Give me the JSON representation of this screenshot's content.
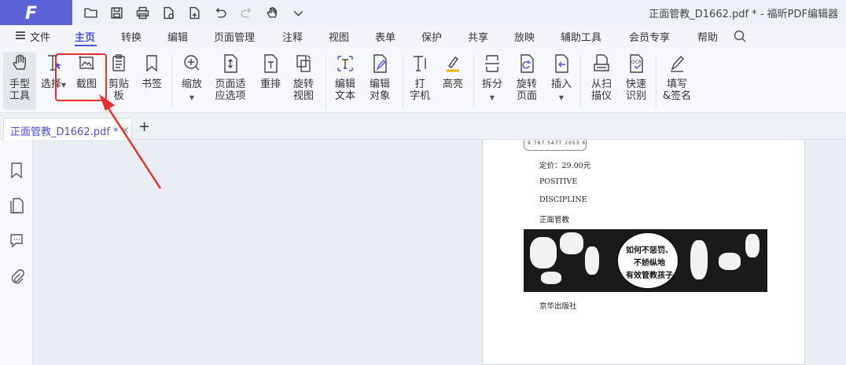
{
  "window": {
    "title": "正面管教_D1662.pdf * - 福昕PDF编辑器",
    "logo_text": "F"
  },
  "quick_access": [
    "open-folder",
    "save",
    "print",
    "page-export",
    "add-page",
    "undo",
    "redo",
    "hand-select",
    "more"
  ],
  "menu": {
    "file": "文件",
    "items": [
      "主页",
      "转换",
      "编辑",
      "页面管理",
      "注释",
      "视图",
      "表单",
      "保护",
      "共享",
      "放映",
      "辅助工具",
      "会员专享",
      "帮助"
    ],
    "active": "主页"
  },
  "ribbon": {
    "hand": "手型\n工具",
    "select": "选择",
    "screenshot": "截图",
    "clipboard": "剪贴\n板",
    "bookmark": "书签",
    "zoom": "缩放",
    "fit_page": "页面适\n应选项",
    "reflow": "重排",
    "rotate_view": "旋转\n视图",
    "edit_text": "编辑\n文本",
    "edit_object": "编辑\n对象",
    "typewriter": "打\n字机",
    "highlight": "高亮",
    "split": "拆分",
    "rotate_page": "旋转\n页面",
    "insert": "插入",
    "from_scanner": "从扫\n描仪",
    "ocr": "快速\n识别",
    "fill_sign": "填写\n&签名"
  },
  "tabs": {
    "doc_tab": "正面管教_D1662.pdf *",
    "close": "×",
    "add": "+"
  },
  "page": {
    "barcode_digits": "9 787 5477 2053 6",
    "price": "定价：29.00元",
    "line1": "POSITIVE",
    "line2": "DISCIPLINE",
    "line3": "正面管教",
    "bubble1": "如何不惩罚、",
    "bubble2": "不娇纵地",
    "bubble3": "有效管教孩子",
    "publisher": "京华出版社"
  },
  "colors": {
    "brand": "#5b63d6",
    "accent": "#4a54d4",
    "highlight_border": "#e8302b",
    "arrow": "#e8302b"
  }
}
